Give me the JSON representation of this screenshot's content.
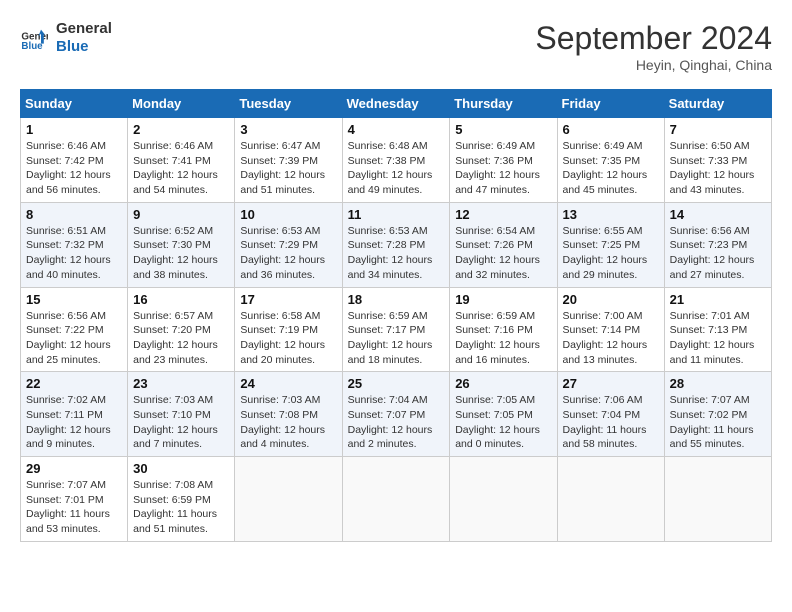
{
  "header": {
    "logo_line1": "General",
    "logo_line2": "Blue",
    "month": "September 2024",
    "location": "Heyin, Qinghai, China"
  },
  "weekdays": [
    "Sunday",
    "Monday",
    "Tuesday",
    "Wednesday",
    "Thursday",
    "Friday",
    "Saturday"
  ],
  "weeks": [
    [
      {
        "day": "1",
        "text": "Sunrise: 6:46 AM\nSunset: 7:42 PM\nDaylight: 12 hours and 56 minutes."
      },
      {
        "day": "2",
        "text": "Sunrise: 6:46 AM\nSunset: 7:41 PM\nDaylight: 12 hours and 54 minutes."
      },
      {
        "day": "3",
        "text": "Sunrise: 6:47 AM\nSunset: 7:39 PM\nDaylight: 12 hours and 51 minutes."
      },
      {
        "day": "4",
        "text": "Sunrise: 6:48 AM\nSunset: 7:38 PM\nDaylight: 12 hours and 49 minutes."
      },
      {
        "day": "5",
        "text": "Sunrise: 6:49 AM\nSunset: 7:36 PM\nDaylight: 12 hours and 47 minutes."
      },
      {
        "day": "6",
        "text": "Sunrise: 6:49 AM\nSunset: 7:35 PM\nDaylight: 12 hours and 45 minutes."
      },
      {
        "day": "7",
        "text": "Sunrise: 6:50 AM\nSunset: 7:33 PM\nDaylight: 12 hours and 43 minutes."
      }
    ],
    [
      {
        "day": "8",
        "text": "Sunrise: 6:51 AM\nSunset: 7:32 PM\nDaylight: 12 hours and 40 minutes."
      },
      {
        "day": "9",
        "text": "Sunrise: 6:52 AM\nSunset: 7:30 PM\nDaylight: 12 hours and 38 minutes."
      },
      {
        "day": "10",
        "text": "Sunrise: 6:53 AM\nSunset: 7:29 PM\nDaylight: 12 hours and 36 minutes."
      },
      {
        "day": "11",
        "text": "Sunrise: 6:53 AM\nSunset: 7:28 PM\nDaylight: 12 hours and 34 minutes."
      },
      {
        "day": "12",
        "text": "Sunrise: 6:54 AM\nSunset: 7:26 PM\nDaylight: 12 hours and 32 minutes."
      },
      {
        "day": "13",
        "text": "Sunrise: 6:55 AM\nSunset: 7:25 PM\nDaylight: 12 hours and 29 minutes."
      },
      {
        "day": "14",
        "text": "Sunrise: 6:56 AM\nSunset: 7:23 PM\nDaylight: 12 hours and 27 minutes."
      }
    ],
    [
      {
        "day": "15",
        "text": "Sunrise: 6:56 AM\nSunset: 7:22 PM\nDaylight: 12 hours and 25 minutes."
      },
      {
        "day": "16",
        "text": "Sunrise: 6:57 AM\nSunset: 7:20 PM\nDaylight: 12 hours and 23 minutes."
      },
      {
        "day": "17",
        "text": "Sunrise: 6:58 AM\nSunset: 7:19 PM\nDaylight: 12 hours and 20 minutes."
      },
      {
        "day": "18",
        "text": "Sunrise: 6:59 AM\nSunset: 7:17 PM\nDaylight: 12 hours and 18 minutes."
      },
      {
        "day": "19",
        "text": "Sunrise: 6:59 AM\nSunset: 7:16 PM\nDaylight: 12 hours and 16 minutes."
      },
      {
        "day": "20",
        "text": "Sunrise: 7:00 AM\nSunset: 7:14 PM\nDaylight: 12 hours and 13 minutes."
      },
      {
        "day": "21",
        "text": "Sunrise: 7:01 AM\nSunset: 7:13 PM\nDaylight: 12 hours and 11 minutes."
      }
    ],
    [
      {
        "day": "22",
        "text": "Sunrise: 7:02 AM\nSunset: 7:11 PM\nDaylight: 12 hours and 9 minutes."
      },
      {
        "day": "23",
        "text": "Sunrise: 7:03 AM\nSunset: 7:10 PM\nDaylight: 12 hours and 7 minutes."
      },
      {
        "day": "24",
        "text": "Sunrise: 7:03 AM\nSunset: 7:08 PM\nDaylight: 12 hours and 4 minutes."
      },
      {
        "day": "25",
        "text": "Sunrise: 7:04 AM\nSunset: 7:07 PM\nDaylight: 12 hours and 2 minutes."
      },
      {
        "day": "26",
        "text": "Sunrise: 7:05 AM\nSunset: 7:05 PM\nDaylight: 12 hours and 0 minutes."
      },
      {
        "day": "27",
        "text": "Sunrise: 7:06 AM\nSunset: 7:04 PM\nDaylight: 11 hours and 58 minutes."
      },
      {
        "day": "28",
        "text": "Sunrise: 7:07 AM\nSunset: 7:02 PM\nDaylight: 11 hours and 55 minutes."
      }
    ],
    [
      {
        "day": "29",
        "text": "Sunrise: 7:07 AM\nSunset: 7:01 PM\nDaylight: 11 hours and 53 minutes."
      },
      {
        "day": "30",
        "text": "Sunrise: 7:08 AM\nSunset: 6:59 PM\nDaylight: 11 hours and 51 minutes."
      },
      {
        "day": "",
        "text": ""
      },
      {
        "day": "",
        "text": ""
      },
      {
        "day": "",
        "text": ""
      },
      {
        "day": "",
        "text": ""
      },
      {
        "day": "",
        "text": ""
      }
    ]
  ]
}
